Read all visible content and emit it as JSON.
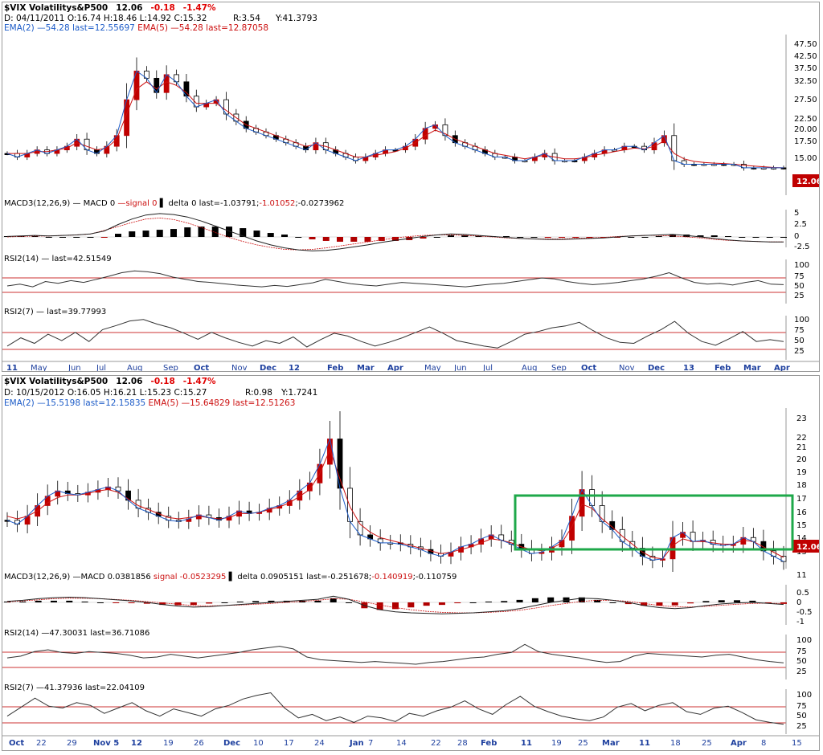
{
  "colors": {
    "ema_fast": "#1d5cc8",
    "ema_slow": "#cc1010",
    "bull": "#000000",
    "bear": "#c00000",
    "highlight_box": "#1ea84a",
    "last_badge": "#c00000"
  },
  "charts": [
    {
      "symbol": "$VIX Volatilitys&P500",
      "last": "12.06",
      "change": "-0.18",
      "change_pct": "-1.47%",
      "ohlc_line": "D: 04/11/2011  O:16.74  H:18.46  L:14.92  C:15.32",
      "r_label": "R:3.54",
      "y_label": "Y:41.3793",
      "ema_fast_label": "EMA(2) —54.28 last=12.55697",
      "ema_slow_label": "EMA(5) —54.28 last=12.87058",
      "macd_label": "MACD3(12,26,9) — MACD 0",
      "macd_signal_label": "—signal 0",
      "macd_delta_label": "▌ delta 0 last=-1.03791;",
      "macd_last_red": "-1.01052",
      "macd_last_tail": ";-0.0273962",
      "rsi14_label": "RSI2(14) — last=42.51549",
      "rsi7_label": "RSI2(7) — last=39.77993",
      "price_ticks": [
        "47.50",
        "42.50",
        "37.50",
        "32.50",
        "27.50",
        "22.50",
        "20.00",
        "17.50",
        "15.00"
      ],
      "macd_ticks": [
        "5",
        "2.5",
        "0",
        "-2.5"
      ],
      "rsi_ticks": [
        "100",
        "75",
        "50",
        "25"
      ],
      "x_labels": [
        "11",
        "May",
        "Jun",
        "Jul",
        "Aug",
        "Sep",
        "Oct",
        "Nov",
        "Dec",
        "12",
        "Feb",
        "Mar",
        "Apr",
        "May",
        "Jun",
        "Jul",
        "Aug",
        "Sep",
        "Oct",
        "Nov",
        "Dec",
        "13",
        "Feb",
        "Mar",
        "Apr"
      ]
    },
    {
      "symbol": "$VIX Volatilitys&P500",
      "last": "12.06",
      "change": "-0.18",
      "change_pct": "-1.47%",
      "ohlc_line": "D: 10/15/2012  O:16.05  H:16.21  L:15.23  C:15.27",
      "r_label": "R:0.98",
      "y_label": "Y:1.7241",
      "ema_fast_label": "EMA(2) —15.5198 last=12.15835",
      "ema_slow_label": "EMA(5) —15.64829 last=12.51263",
      "macd_label": "MACD3(12,26,9) —MACD 0.0381856",
      "macd_signal_label": "signal -0.0523295",
      "macd_delta_label": "▌ delta 0.0905151 last=-0.251678;",
      "macd_last_red": "-0.140919",
      "macd_last_tail": ";-0.110759",
      "rsi14_label": "RSI2(14) —47.30031 last=36.71086",
      "rsi7_label": "RSI2(7) —41.37936 last=22.04109",
      "price_ticks": [
        "23",
        "22",
        "21",
        "20",
        "19",
        "18",
        "17",
        "16",
        "15",
        "14",
        "13",
        "11"
      ],
      "macd_ticks": [
        "0.5",
        "0",
        "-0.5",
        "-1"
      ],
      "rsi_ticks": [
        "100",
        "75",
        "50",
        "25"
      ],
      "x_labels": [
        "Oct",
        "22",
        "29",
        "Nov 5",
        "12",
        "19",
        "26",
        "Dec",
        "10",
        "17",
        "24",
        "Jan",
        "7",
        "14",
        "22",
        "28",
        "Feb",
        "11",
        "19",
        "25",
        "Mar",
        "11",
        "18",
        "25",
        "Apr",
        "8",
        "15"
      ]
    }
  ],
  "chart_data": [
    {
      "type": "candlestick",
      "title": "$VIX Volatilitys&P500",
      "x_range": [
        "Apr 2011",
        "Apr 2013"
      ],
      "ylim": [
        12,
        47.5
      ],
      "log_scale": false,
      "last_value": 12.06,
      "ema_series": [
        {
          "name": "EMA(2)",
          "values": [
            17,
            16,
            17,
            18,
            17,
            18,
            19,
            21,
            18,
            17,
            19,
            22,
            32,
            40,
            38,
            34,
            39,
            37,
            33,
            30,
            31,
            32,
            28,
            26,
            24,
            23,
            22,
            21,
            20,
            19,
            18,
            20,
            18,
            17,
            16,
            15,
            16,
            17,
            18,
            18,
            19,
            21,
            24,
            25,
            22,
            20,
            19,
            18,
            17,
            16,
            16,
            15,
            15,
            16,
            17,
            15,
            15,
            15,
            16,
            17,
            18,
            18,
            19,
            19,
            18,
            20,
            22,
            15,
            14,
            14,
            14,
            14,
            14,
            14,
            13,
            13,
            13,
            13,
            13
          ]
        },
        {
          "name": "EMA(5)",
          "values": [
            17,
            17,
            17,
            17.5,
            17.5,
            18,
            18.5,
            20,
            19,
            18,
            18.5,
            21,
            28,
            35,
            37,
            35,
            37,
            36,
            34,
            31,
            31,
            31,
            29,
            27,
            25,
            24,
            23,
            22,
            21,
            20,
            19,
            19.5,
            19,
            18,
            17,
            16,
            16,
            16.5,
            17,
            17.5,
            18.5,
            20,
            22,
            23.5,
            22.5,
            21,
            20,
            19,
            18,
            17,
            16.5,
            16,
            15.5,
            16,
            16.5,
            16,
            15.5,
            15.5,
            15.8,
            16.5,
            17,
            17.5,
            18,
            18.5,
            18.3,
            19,
            20.5,
            17,
            15.5,
            14.8,
            14.5,
            14.3,
            14.2,
            14,
            13.7,
            13.5,
            13.3,
            13.1,
            13
          ]
        }
      ],
      "macd": {
        "macd": [
          0.1,
          0.2,
          0.3,
          0.2,
          0.3,
          0.4,
          0.6,
          1.2,
          2.5,
          3.6,
          4.4,
          4.7,
          4.5,
          4,
          3.2,
          2.2,
          1.2,
          0.2,
          -0.8,
          -1.6,
          -2.2,
          -2.6,
          -2.8,
          -2.7,
          -2.4,
          -2,
          -1.6,
          -1.1,
          -0.7,
          -0.3,
          0.1,
          0.4,
          0.6,
          0.5,
          0.3,
          0.1,
          -0.1,
          -0.3,
          -0.4,
          -0.5,
          -0.5,
          -0.4,
          -0.3,
          -0.2,
          0,
          0.2,
          0.3,
          0.4,
          0.5,
          0.3,
          0,
          -0.3,
          -0.6,
          -0.8,
          -0.9,
          -1,
          -1
        ],
        "signal": [
          0,
          0.1,
          0.2,
          0.2,
          0.3,
          0.4,
          0.6,
          1.3,
          2.1,
          2.9,
          3.6,
          3.8,
          3.5,
          2.8,
          1.9,
          0.9,
          -0.1,
          -0.9,
          -1.6,
          -2.1,
          -2.5,
          -2.6,
          -2.5,
          -2.2,
          -1.8,
          -1.4,
          -1,
          -0.6,
          -0.2,
          0.1,
          0.3,
          0.4,
          0.4,
          0.3,
          0.2,
          0,
          -0.2,
          -0.3,
          -0.4,
          -0.4,
          -0.4,
          -0.3,
          -0.2,
          -0.1,
          0.1,
          0.2,
          0.3,
          0.3,
          0.2,
          0,
          -0.2,
          -0.5,
          -0.7,
          -0.8,
          -0.9,
          -1,
          -1
        ]
      },
      "rsi14": [
        40,
        44,
        38,
        50,
        46,
        52,
        48,
        55,
        62,
        70,
        74,
        72,
        68,
        60,
        55,
        50,
        48,
        45,
        42,
        40,
        38,
        41,
        39,
        43,
        47,
        55,
        50,
        45,
        42,
        40,
        44,
        48,
        46,
        44,
        42,
        40,
        38,
        41,
        44,
        46,
        50,
        54,
        58,
        56,
        50,
        46,
        43,
        45,
        48,
        52,
        56,
        62,
        70,
        58,
        48,
        44,
        46,
        42,
        48,
        52,
        44,
        43
      ],
      "rsi7": [
        30,
        48,
        36,
        56,
        42,
        60,
        40,
        66,
        75,
        85,
        88,
        78,
        70,
        58,
        45,
        60,
        48,
        38,
        30,
        42,
        36,
        50,
        28,
        44,
        58,
        52,
        40,
        30,
        38,
        48,
        60,
        72,
        58,
        42,
        36,
        30,
        26,
        40,
        56,
        62,
        70,
        74,
        82,
        64,
        48,
        38,
        36,
        52,
        66,
        84,
        58,
        40,
        32,
        46,
        62,
        40,
        44,
        40
      ]
    },
    {
      "type": "candlestick",
      "title": "$VIX Volatilitys&P500",
      "x_range": [
        "Oct 15 2012",
        "Apr 15 2013"
      ],
      "ylim": [
        11,
        23
      ],
      "last_value": 12.06,
      "annotation": "green rectangle highlighting range 12.5 - 15.5 from Feb 11 to Apr 15",
      "ema_series": [
        {
          "name": "EMA(2)",
          "values": [
            15.3,
            15,
            15.6,
            16.4,
            17.1,
            17.5,
            17.3,
            17.2,
            17.4,
            17.6,
            17.8,
            17.5,
            16.8,
            16.2,
            15.9,
            15.6,
            15.3,
            15.2,
            15.4,
            15.7,
            15.5,
            15.3,
            15.6,
            16,
            15.8,
            15.9,
            16.2,
            16.4,
            16.8,
            17.5,
            18.1,
            19.5,
            21.4,
            17.7,
            15.2,
            14.2,
            13.9,
            13.6,
            13.6,
            13.5,
            13.3,
            13.1,
            12.8,
            12.6,
            12.9,
            13.3,
            13.5,
            13.9,
            14.2,
            13.8,
            13.5,
            13.1,
            12.8,
            12.9,
            13.3,
            13.8,
            15.6,
            17.6,
            16.4,
            15.2,
            14.6,
            13.7,
            13.2,
            12.6,
            12.3,
            12.4,
            14,
            14.4,
            13.7,
            13.8,
            13.5,
            13.4,
            13.5,
            14,
            13.7,
            13,
            12.6,
            12.2
          ]
        },
        {
          "name": "EMA(5)",
          "values": [
            15.6,
            15.4,
            15.6,
            16,
            16.6,
            17,
            17.2,
            17.2,
            17.3,
            17.5,
            17.6,
            17.4,
            16.9,
            16.4,
            16.1,
            15.8,
            15.5,
            15.4,
            15.5,
            15.6,
            15.5,
            15.4,
            15.5,
            15.8,
            15.8,
            15.9,
            16.1,
            16.3,
            16.6,
            17.1,
            17.6,
            18.8,
            20.6,
            18.4,
            16.3,
            15,
            14.4,
            14,
            13.8,
            13.6,
            13.4,
            13.2,
            13,
            12.8,
            12.9,
            13.1,
            13.3,
            13.6,
            13.9,
            13.8,
            13.6,
            13.3,
            13.1,
            13,
            13.2,
            13.6,
            14.8,
            16.5,
            16.2,
            15.4,
            14.8,
            14.1,
            13.5,
            12.9,
            12.5,
            12.4,
            13.4,
            13.9,
            13.7,
            13.7,
            13.6,
            13.5,
            13.5,
            13.8,
            13.7,
            13.3,
            12.9,
            12.5
          ]
        }
      ],
      "macd": {
        "macd": [
          0.1,
          0.2,
          0.35,
          0.45,
          0.5,
          0.45,
          0.35,
          0.25,
          0.15,
          0,
          -0.2,
          -0.35,
          -0.45,
          -0.4,
          -0.3,
          -0.2,
          -0.1,
          0,
          0.1,
          0.2,
          0.3,
          0.6,
          0.3,
          -0.3,
          -0.7,
          -0.9,
          -1,
          -1.05,
          -1.1,
          -1.05,
          -1,
          -0.9,
          -0.8,
          -0.6,
          -0.3,
          0,
          0.2,
          0.4,
          0.35,
          0.2,
          0,
          -0.3,
          -0.5,
          -0.6,
          -0.5,
          -0.3,
          -0.15,
          -0.05,
          0,
          -0.1,
          -0.2
        ],
        "signal": [
          0.05,
          0.15,
          0.25,
          0.35,
          0.4,
          0.4,
          0.35,
          0.28,
          0.2,
          0.08,
          -0.05,
          -0.18,
          -0.3,
          -0.33,
          -0.3,
          -0.25,
          -0.18,
          -0.1,
          0,
          0.1,
          0.2,
          0.35,
          0.3,
          0.05,
          -0.25,
          -0.5,
          -0.7,
          -0.85,
          -0.95,
          -1,
          -1,
          -0.95,
          -0.88,
          -0.75,
          -0.55,
          -0.3,
          -0.1,
          0.1,
          0.2,
          0.2,
          0.1,
          -0.1,
          -0.3,
          -0.42,
          -0.44,
          -0.38,
          -0.28,
          -0.18,
          -0.1,
          -0.08,
          -0.11
        ]
      },
      "rsi14": [
        48,
        52,
        62,
        66,
        60,
        58,
        62,
        60,
        58,
        54,
        48,
        50,
        56,
        52,
        48,
        52,
        56,
        60,
        66,
        70,
        74,
        68,
        50,
        44,
        42,
        40,
        38,
        40,
        38,
        36,
        34,
        38,
        40,
        44,
        48,
        50,
        56,
        60,
        78,
        62,
        56,
        52,
        48,
        42,
        38,
        40,
        52,
        58,
        56,
        54,
        52,
        50,
        54,
        56,
        50,
        44,
        40,
        37
      ],
      "rsi7": [
        40,
        60,
        80,
        62,
        58,
        70,
        64,
        46,
        58,
        70,
        52,
        40,
        56,
        48,
        40,
        56,
        64,
        78,
        86,
        92,
        58,
        36,
        44,
        30,
        38,
        26,
        40,
        36,
        28,
        46,
        40,
        52,
        60,
        74,
        56,
        44,
        66,
        84,
        62,
        50,
        40,
        34,
        30,
        38,
        60,
        68,
        52,
        64,
        70,
        50,
        44,
        58,
        62,
        48,
        32,
        26,
        22
      ]
    }
  ]
}
